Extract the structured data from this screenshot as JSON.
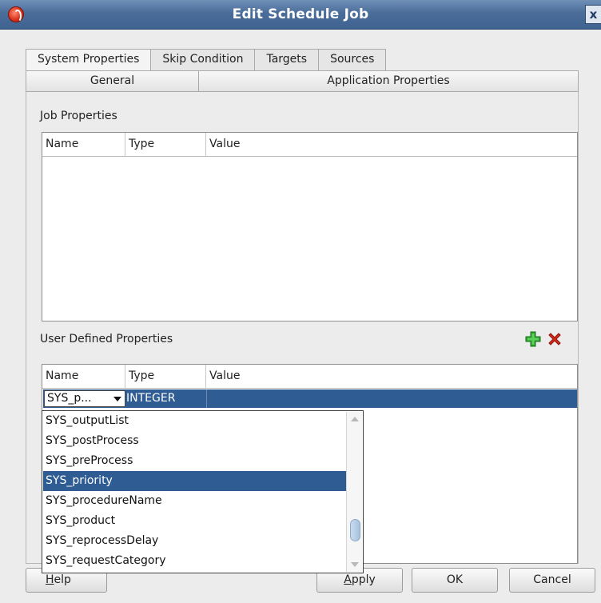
{
  "window": {
    "title": "Edit Schedule Job",
    "close_glyph": "x",
    "logo_icon": "oracle-logo-icon",
    "close_icon": "close-icon"
  },
  "tabs_primary": [
    {
      "label": "System Properties",
      "active": true
    },
    {
      "label": "Skip Condition",
      "active": false
    },
    {
      "label": "Targets",
      "active": false
    },
    {
      "label": "Sources",
      "active": false
    }
  ],
  "tabs_secondary": [
    {
      "label": "General",
      "active": false
    },
    {
      "label": "Application Properties",
      "active": true
    }
  ],
  "job_properties": {
    "label": "Job Properties",
    "columns": [
      "Name",
      "Type",
      "Value"
    ]
  },
  "user_defined_properties": {
    "label": "User Defined Properties",
    "add_icon": "plus-icon",
    "remove_icon": "delete-icon",
    "columns": [
      "Name",
      "Type",
      "Value"
    ],
    "row": {
      "name_combo": "SYS_p...",
      "type": "INTEGER",
      "value": ""
    }
  },
  "dropdown": {
    "items": [
      "SYS_outputList",
      "SYS_postProcess",
      "SYS_preProcess",
      "SYS_priority",
      "SYS_procedureName",
      "SYS_product",
      "SYS_reprocessDelay",
      "SYS_requestCategory"
    ],
    "selected": "SYS_priority"
  },
  "buttons": {
    "help_mnemonic": "H",
    "help_rest": "elp",
    "apply_mnemonic": "A",
    "apply_rest": "pply",
    "ok": "OK",
    "cancel": "Cancel"
  },
  "colors": {
    "title_bar": "#4a6d9a",
    "selection": "#2f5d93",
    "add_icon": "#2fa52f",
    "remove_icon": "#d8281c"
  }
}
